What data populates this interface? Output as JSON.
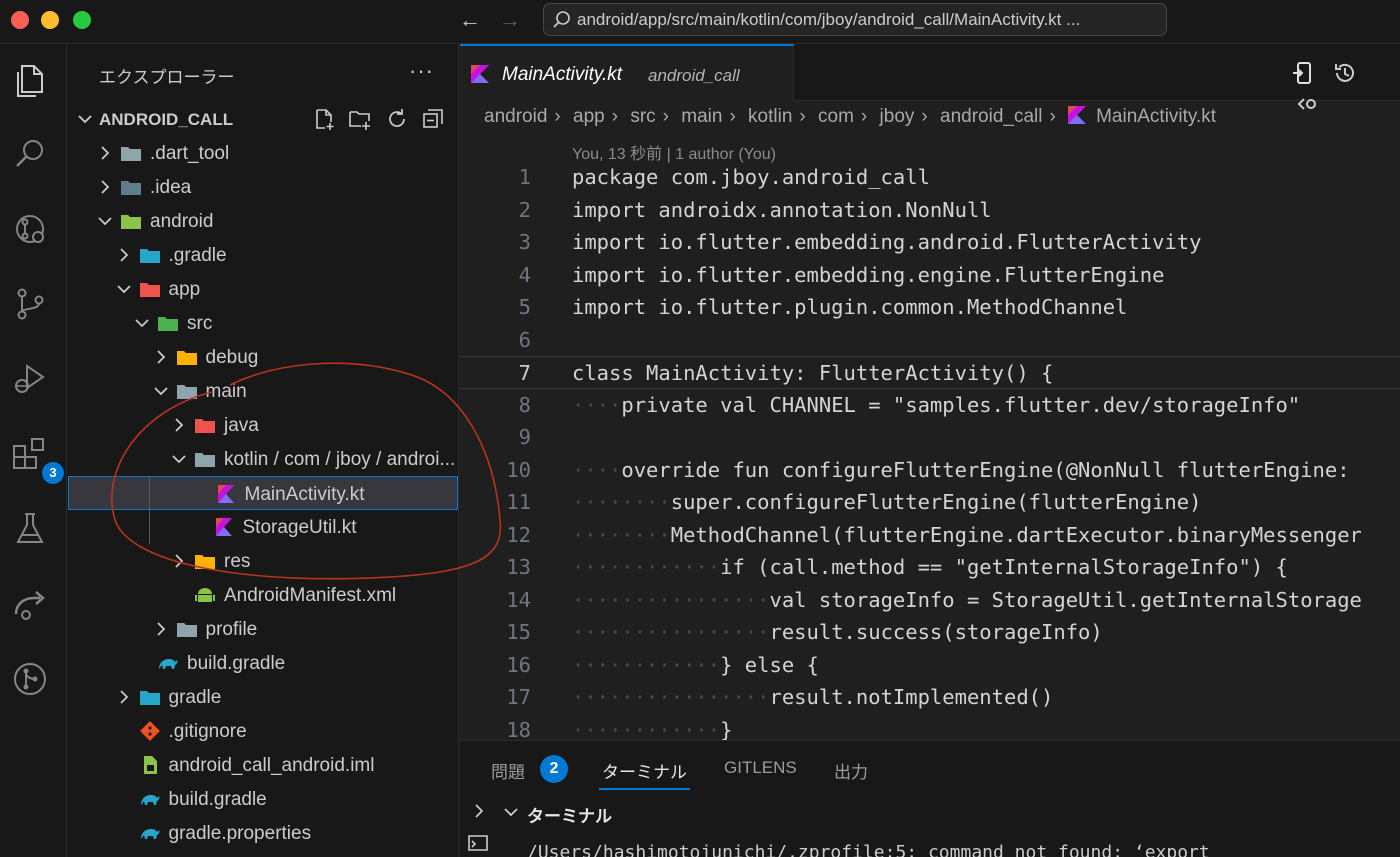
{
  "window": {
    "nav_back": "←",
    "nav_forward": "→",
    "command_center_text": "android/app/src/main/kotlin/com/jboy/android_call/MainActivity.kt ..."
  },
  "activity_bar": {
    "extensions_badge": "3"
  },
  "sidebar": {
    "title": "エクスプローラー",
    "more": "···",
    "section_name": "ANDROID_CALL",
    "tree": [
      {
        "label": ".dart_tool",
        "depth": 0,
        "chevron": "right",
        "icon": "folder-icon"
      },
      {
        "label": ".idea",
        "depth": 0,
        "chevron": "right",
        "icon": "idea-folder-icon"
      },
      {
        "label": "android",
        "depth": 0,
        "chevron": "down",
        "icon": "android-folder-icon"
      },
      {
        "label": ".gradle",
        "depth": 1,
        "chevron": "right",
        "icon": "gradle-folder-icon"
      },
      {
        "label": "app",
        "depth": 1,
        "chevron": "down",
        "icon": "app-folder-icon"
      },
      {
        "label": "src",
        "depth": 2,
        "chevron": "down",
        "icon": "src-folder-icon"
      },
      {
        "label": "debug",
        "depth": 3,
        "chevron": "right",
        "icon": "debug-folder-icon"
      },
      {
        "label": "main",
        "depth": 3,
        "chevron": "down",
        "icon": "folder-open-icon"
      },
      {
        "label": "java",
        "depth": 4,
        "chevron": "right",
        "icon": "java-folder-icon"
      },
      {
        "label": "kotlin / com / jboy / androi...",
        "depth": 4,
        "chevron": "down",
        "icon": "folder-open-icon"
      },
      {
        "label": "MainActivity.kt",
        "depth": 5,
        "chevron": "none",
        "icon": "kotlin-icon",
        "selected": true
      },
      {
        "label": "StorageUtil.kt",
        "depth": 5,
        "chevron": "none",
        "icon": "kotlin-icon"
      },
      {
        "label": "res",
        "depth": 4,
        "chevron": "right",
        "icon": "res-folder-icon"
      },
      {
        "label": "AndroidManifest.xml",
        "depth": 4,
        "chevron": "none",
        "icon": "android-icon"
      },
      {
        "label": "profile",
        "depth": 3,
        "chevron": "right",
        "icon": "folder-icon"
      },
      {
        "label": "build.gradle",
        "depth": 2,
        "chevron": "none",
        "icon": "gradle-icon"
      },
      {
        "label": "gradle",
        "depth": 1,
        "chevron": "right",
        "icon": "gradle-folder-icon"
      },
      {
        "label": ".gitignore",
        "depth": 1,
        "chevron": "none",
        "icon": "git-icon"
      },
      {
        "label": "android_call_android.iml",
        "depth": 1,
        "chevron": "none",
        "icon": "iml-icon"
      },
      {
        "label": "build.gradle",
        "depth": 1,
        "chevron": "none",
        "icon": "gradle-icon"
      },
      {
        "label": "gradle.properties",
        "depth": 1,
        "chevron": "none",
        "icon": "gradle-icon"
      }
    ]
  },
  "editor": {
    "tab_name": "MainActivity.kt",
    "tab_description": "android_call",
    "breadcrumb": [
      "android",
      "app",
      "src",
      "main",
      "kotlin",
      "com",
      "jboy",
      "android_call"
    ],
    "breadcrumb_file": "MainActivity.kt",
    "blame": "You, 13 秒前 | 1 author (You)",
    "current_line": 7,
    "lines": [
      {
        "n": "1",
        "indent": "",
        "text": "package com.jboy.android_call"
      },
      {
        "n": "2",
        "indent": "",
        "text": "import androidx.annotation.NonNull"
      },
      {
        "n": "3",
        "indent": "",
        "text": "import io.flutter.embedding.android.FlutterActivity"
      },
      {
        "n": "4",
        "indent": "",
        "text": "import io.flutter.embedding.engine.FlutterEngine"
      },
      {
        "n": "5",
        "indent": "",
        "text": "import io.flutter.plugin.common.MethodChannel"
      },
      {
        "n": "6",
        "indent": "",
        "text": ""
      },
      {
        "n": "7",
        "indent": "",
        "text": "class MainActivity: FlutterActivity() {"
      },
      {
        "n": "8",
        "indent": "····",
        "text": "private val CHANNEL = \"samples.flutter.dev/storageInfo\""
      },
      {
        "n": "9",
        "indent": "",
        "text": ""
      },
      {
        "n": "10",
        "indent": "····",
        "text": "override fun configureFlutterEngine(@NonNull flutterEngine: "
      },
      {
        "n": "11",
        "indent": "········",
        "text": "super.configureFlutterEngine(flutterEngine)"
      },
      {
        "n": "12",
        "indent": "········",
        "text": "MethodChannel(flutterEngine.dartExecutor.binaryMessenger"
      },
      {
        "n": "13",
        "indent": "············",
        "text": "if (call.method == \"getInternalStorageInfo\") {"
      },
      {
        "n": "14",
        "indent": "················",
        "text": "val storageInfo = StorageUtil.getInternalStorage"
      },
      {
        "n": "15",
        "indent": "················",
        "text": "result.success(storageInfo)"
      },
      {
        "n": "16",
        "indent": "············",
        "text": "} else {"
      },
      {
        "n": "17",
        "indent": "················",
        "text": "result.notImplemented()"
      },
      {
        "n": "18",
        "indent": "············",
        "text": "}"
      }
    ]
  },
  "panel": {
    "tabs": [
      "問題",
      "ターミナル",
      "GITLENS",
      "出力"
    ],
    "problems_count": "2",
    "active_tab": "ターミナル",
    "terminal_title": "ターミナル",
    "terminal_line": "/Users/hashimotojunichi/.zprofile:5: command not found: ‘export"
  },
  "colors": {
    "accent": "#0078d4",
    "annotation": "#c0392b"
  }
}
